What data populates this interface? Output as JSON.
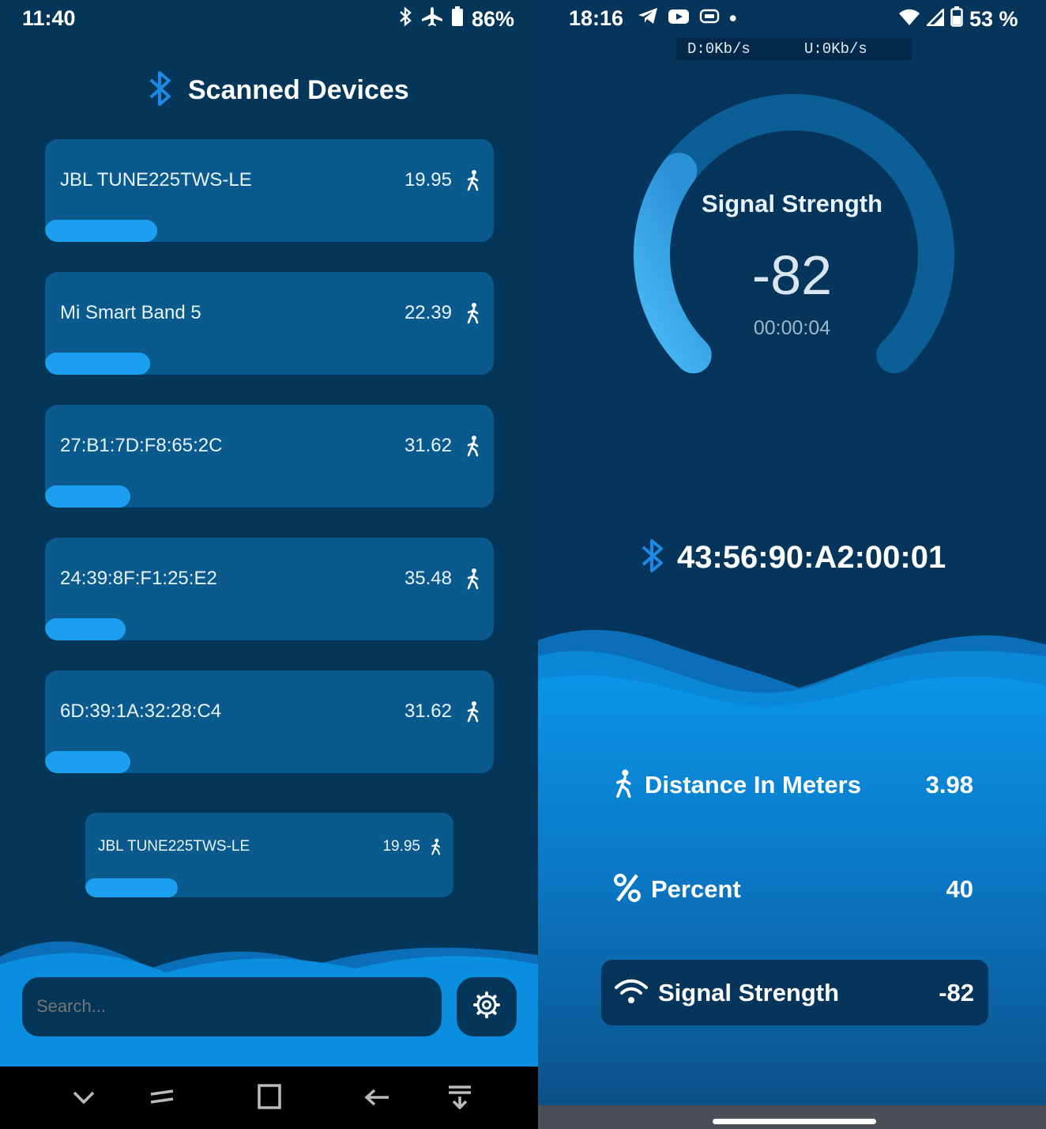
{
  "left": {
    "status_bar": {
      "time": "11:40",
      "battery": "86%"
    },
    "title": "Scanned Devices",
    "devices": [
      {
        "name": "JBL TUNE225TWS-LE",
        "distance": "19.95",
        "signal_fraction": 0.25
      },
      {
        "name": "Mi Smart Band 5",
        "distance": "22.39",
        "signal_fraction": 0.235
      },
      {
        "name": "27:B1:7D:F8:65:2C",
        "distance": "31.62",
        "signal_fraction": 0.19
      },
      {
        "name": "24:39:8F:F1:25:E2",
        "distance": "35.48",
        "signal_fraction": 0.18
      },
      {
        "name": "6D:39:1A:32:28:C4",
        "distance": "31.62",
        "signal_fraction": 0.19
      }
    ],
    "preview_device": {
      "name": "JBL TUNE225TWS-LE",
      "distance": "19.95",
      "signal_fraction": 0.25
    },
    "search": {
      "placeholder": "Search..."
    },
    "icons": {
      "title": "bluetooth-icon",
      "settings": "gear-icon",
      "distance": "walking-person-icon",
      "nav": [
        "chevron-down-icon",
        "switch-apps-icon",
        "home-square-icon",
        "back-arrow-icon",
        "pull-down-icon"
      ]
    },
    "colors": {
      "background": "#04365a",
      "card": "#0a5a8e",
      "bar": "#1aa0ef",
      "accent": "#1e88e5"
    }
  },
  "right": {
    "status_bar": {
      "time": "18:16",
      "battery": "53 %"
    },
    "net_speed": {
      "down": "D:0Kb/s",
      "up": "U:0Kb/s"
    },
    "gauge": {
      "title": "Signal Strength",
      "value": "-82",
      "timer": "00:00:04",
      "fill_fraction": 0.3
    },
    "device": {
      "mac": "43:56:90:A2:00:01"
    },
    "stats": [
      {
        "label": "Distance In Meters",
        "value": "3.98",
        "icon": "walking-person-icon"
      },
      {
        "label": "Percent",
        "value": "40",
        "icon": "percent-icon"
      },
      {
        "label": "Signal Strength",
        "value": "-82",
        "icon": "wifi-icon"
      }
    ],
    "colors": {
      "gauge_track": "#0b5f96",
      "gauge_fill": "#4fb3f0",
      "wave": "#0a8fe0"
    }
  }
}
